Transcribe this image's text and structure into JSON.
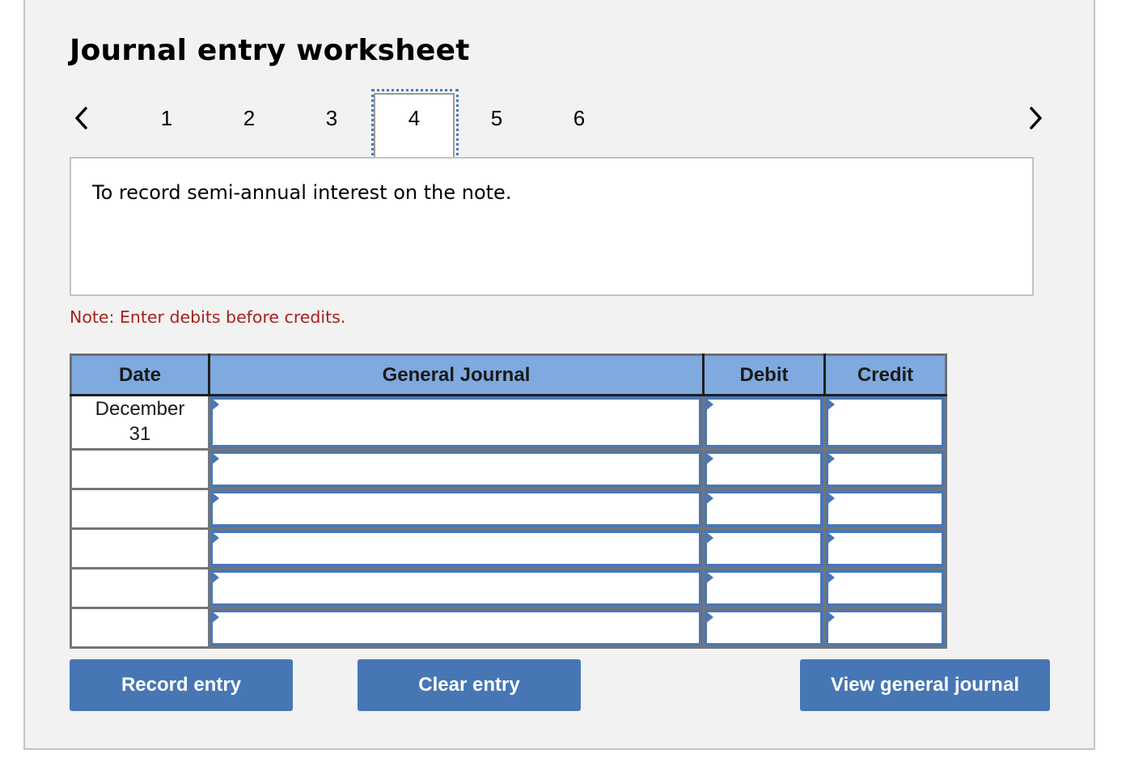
{
  "header": {
    "title": "Journal entry worksheet"
  },
  "pagination": {
    "prev_icon": "chevron-left-icon",
    "next_icon": "chevron-right-icon",
    "pages": [
      "1",
      "2",
      "3",
      "4",
      "5",
      "6"
    ],
    "active_page": "4"
  },
  "description": {
    "text": "To record semi-annual interest on the note."
  },
  "note": {
    "text": "Note: Enter debits before credits."
  },
  "table": {
    "headers": {
      "date": "Date",
      "general_journal": "General Journal",
      "debit": "Debit",
      "credit": "Credit"
    },
    "rows": [
      {
        "date_line1": "December",
        "date_line2": "31",
        "account": "",
        "debit": "",
        "credit": ""
      },
      {
        "date_line1": "",
        "date_line2": "",
        "account": "",
        "debit": "",
        "credit": ""
      },
      {
        "date_line1": "",
        "date_line2": "",
        "account": "",
        "debit": "",
        "credit": ""
      },
      {
        "date_line1": "",
        "date_line2": "",
        "account": "",
        "debit": "",
        "credit": ""
      },
      {
        "date_line1": "",
        "date_line2": "",
        "account": "",
        "debit": "",
        "credit": ""
      },
      {
        "date_line1": "",
        "date_line2": "",
        "account": "",
        "debit": "",
        "credit": ""
      }
    ]
  },
  "buttons": {
    "record_entry": "Record entry",
    "clear_entry": "Clear entry",
    "view_general_journal": "View general journal"
  },
  "colors": {
    "header_bg": "#7faadf",
    "button_bg": "#4677b4",
    "note_text": "#a7211c",
    "input_border": "#4a77b4"
  }
}
